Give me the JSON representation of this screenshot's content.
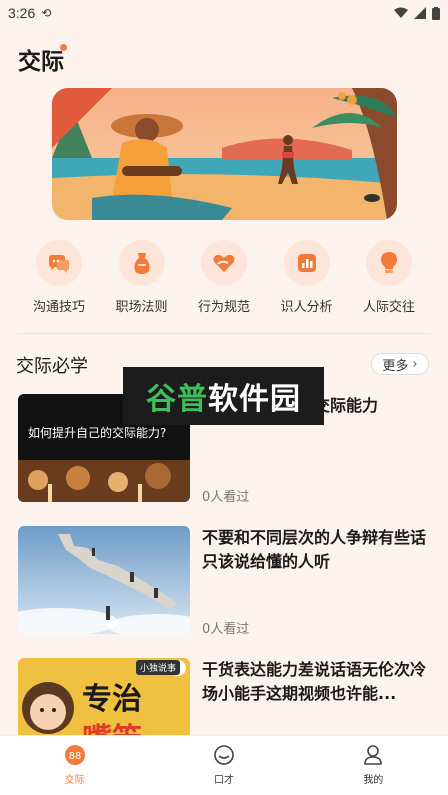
{
  "status_bar": {
    "time": "3:26"
  },
  "header": {
    "title": "交际"
  },
  "categories": [
    {
      "label": "沟通技巧",
      "icon": "chat-bubble-icon"
    },
    {
      "label": "职场法则",
      "icon": "vase-icon"
    },
    {
      "label": "行为规范",
      "icon": "heart-hands-icon"
    },
    {
      "label": "识人分析",
      "icon": "chart-icon"
    },
    {
      "label": "人际交往",
      "icon": "lightbulb-icon"
    }
  ],
  "section": {
    "title": "交际必学",
    "more_label": "更多"
  },
  "articles": [
    {
      "title": "如何提升自己的交际能力",
      "thumb_text": "如何提升自己的交际能力?",
      "views": "0人看过"
    },
    {
      "title": "不要和不同层次的人争辩有些话只该说给懂的人听",
      "views": "0人看过"
    },
    {
      "title": "干货表达能力差说话语无伦次冷场小能手这期视频也许能...",
      "thumb_tag": "小独说事",
      "thumb_big1": "专治",
      "thumb_big2": "嘴笨"
    }
  ],
  "watermark": {
    "part1": "谷普",
    "part2": "软件园"
  },
  "tabs": [
    {
      "label": "交际",
      "active": true
    },
    {
      "label": "口才",
      "active": false
    },
    {
      "label": "我的",
      "active": false
    }
  ],
  "colors": {
    "accent": "#f47a3a",
    "background": "#fdf3ee",
    "icon_bg": "#fde6d9"
  }
}
